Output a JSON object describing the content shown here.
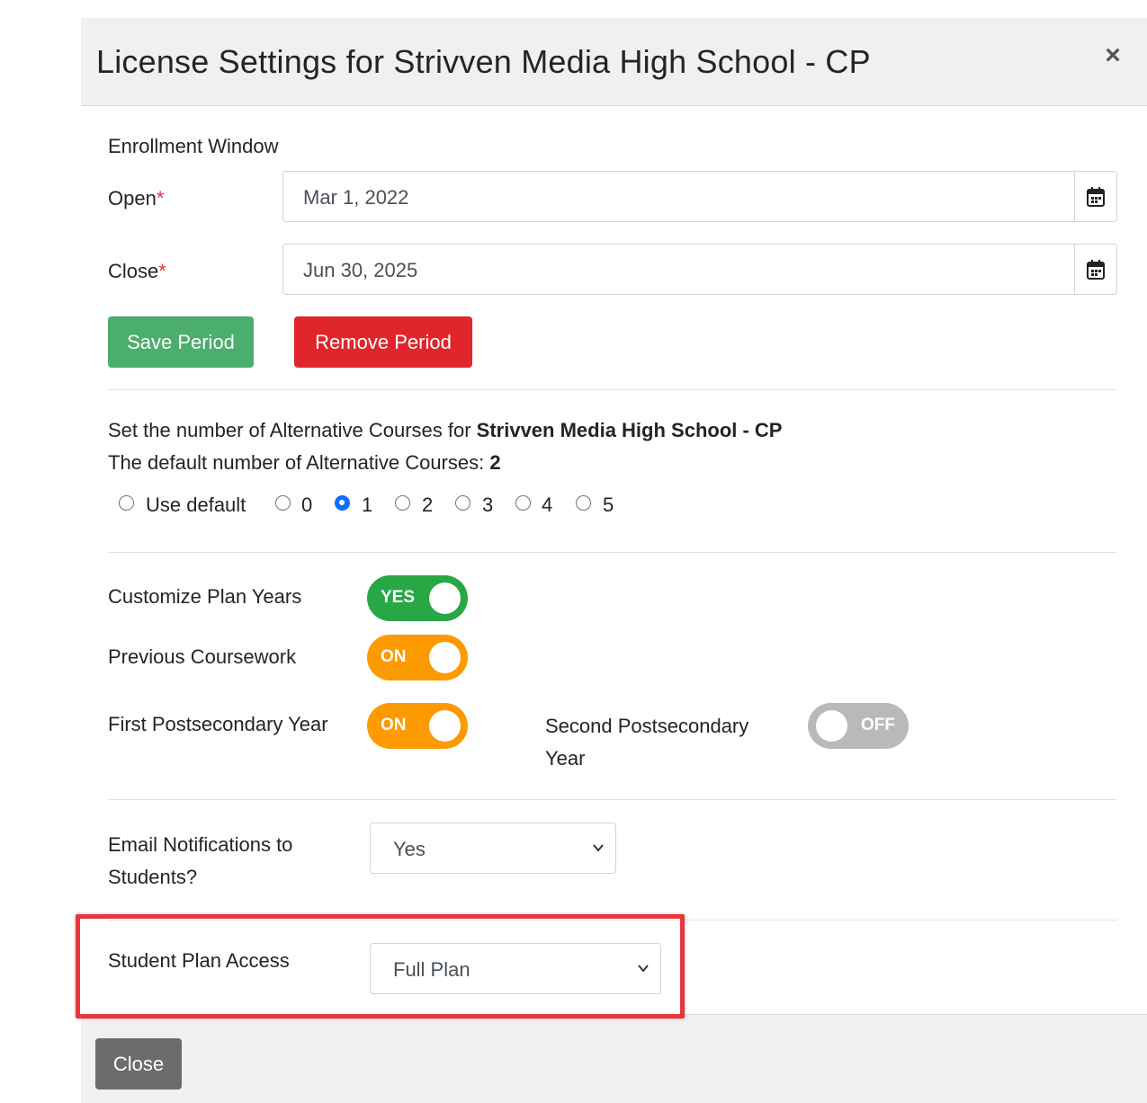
{
  "modal": {
    "title": "License Settings for Strivven Media High School - CP",
    "close_icon": "×"
  },
  "enrollment": {
    "heading": "Enrollment Window",
    "open_label": "Open",
    "open_value": "Mar 1, 2022",
    "close_label": "Close",
    "close_value": "Jun 30, 2025",
    "required_marker": "*",
    "save_button": "Save Period",
    "remove_button": "Remove Period"
  },
  "alt_courses": {
    "line1_prefix": "Set the number of Alternative Courses for ",
    "line1_school": "Strivven Media High School - CP",
    "line2_prefix": "The default number of Alternative Courses: ",
    "line2_default": "2",
    "options": [
      "Use default",
      "0",
      "1",
      "2",
      "3",
      "4",
      "5"
    ],
    "selected": "1"
  },
  "toggles": {
    "customize_plan_years": {
      "label": "Customize Plan Years",
      "state": "YES",
      "color": "#28a745"
    },
    "previous_coursework": {
      "label": "Previous Coursework",
      "state": "ON",
      "color": "#fd9a00"
    },
    "first_postsecondary": {
      "label": "First Postsecondary Year",
      "state": "ON",
      "color": "#fd9a00"
    },
    "second_postsecondary": {
      "label_line1": "Second Postsecondary",
      "label_line2": "Year",
      "state": "OFF",
      "color": "#b9b9b9"
    }
  },
  "email_notifications": {
    "label_line1": "Email Notifications to",
    "label_line2": "Students?",
    "value": "Yes"
  },
  "student_plan_access": {
    "label": "Student Plan Access",
    "value": "Full Plan",
    "highlight_color": "#e5383d"
  },
  "footer": {
    "close_button": "Close"
  }
}
